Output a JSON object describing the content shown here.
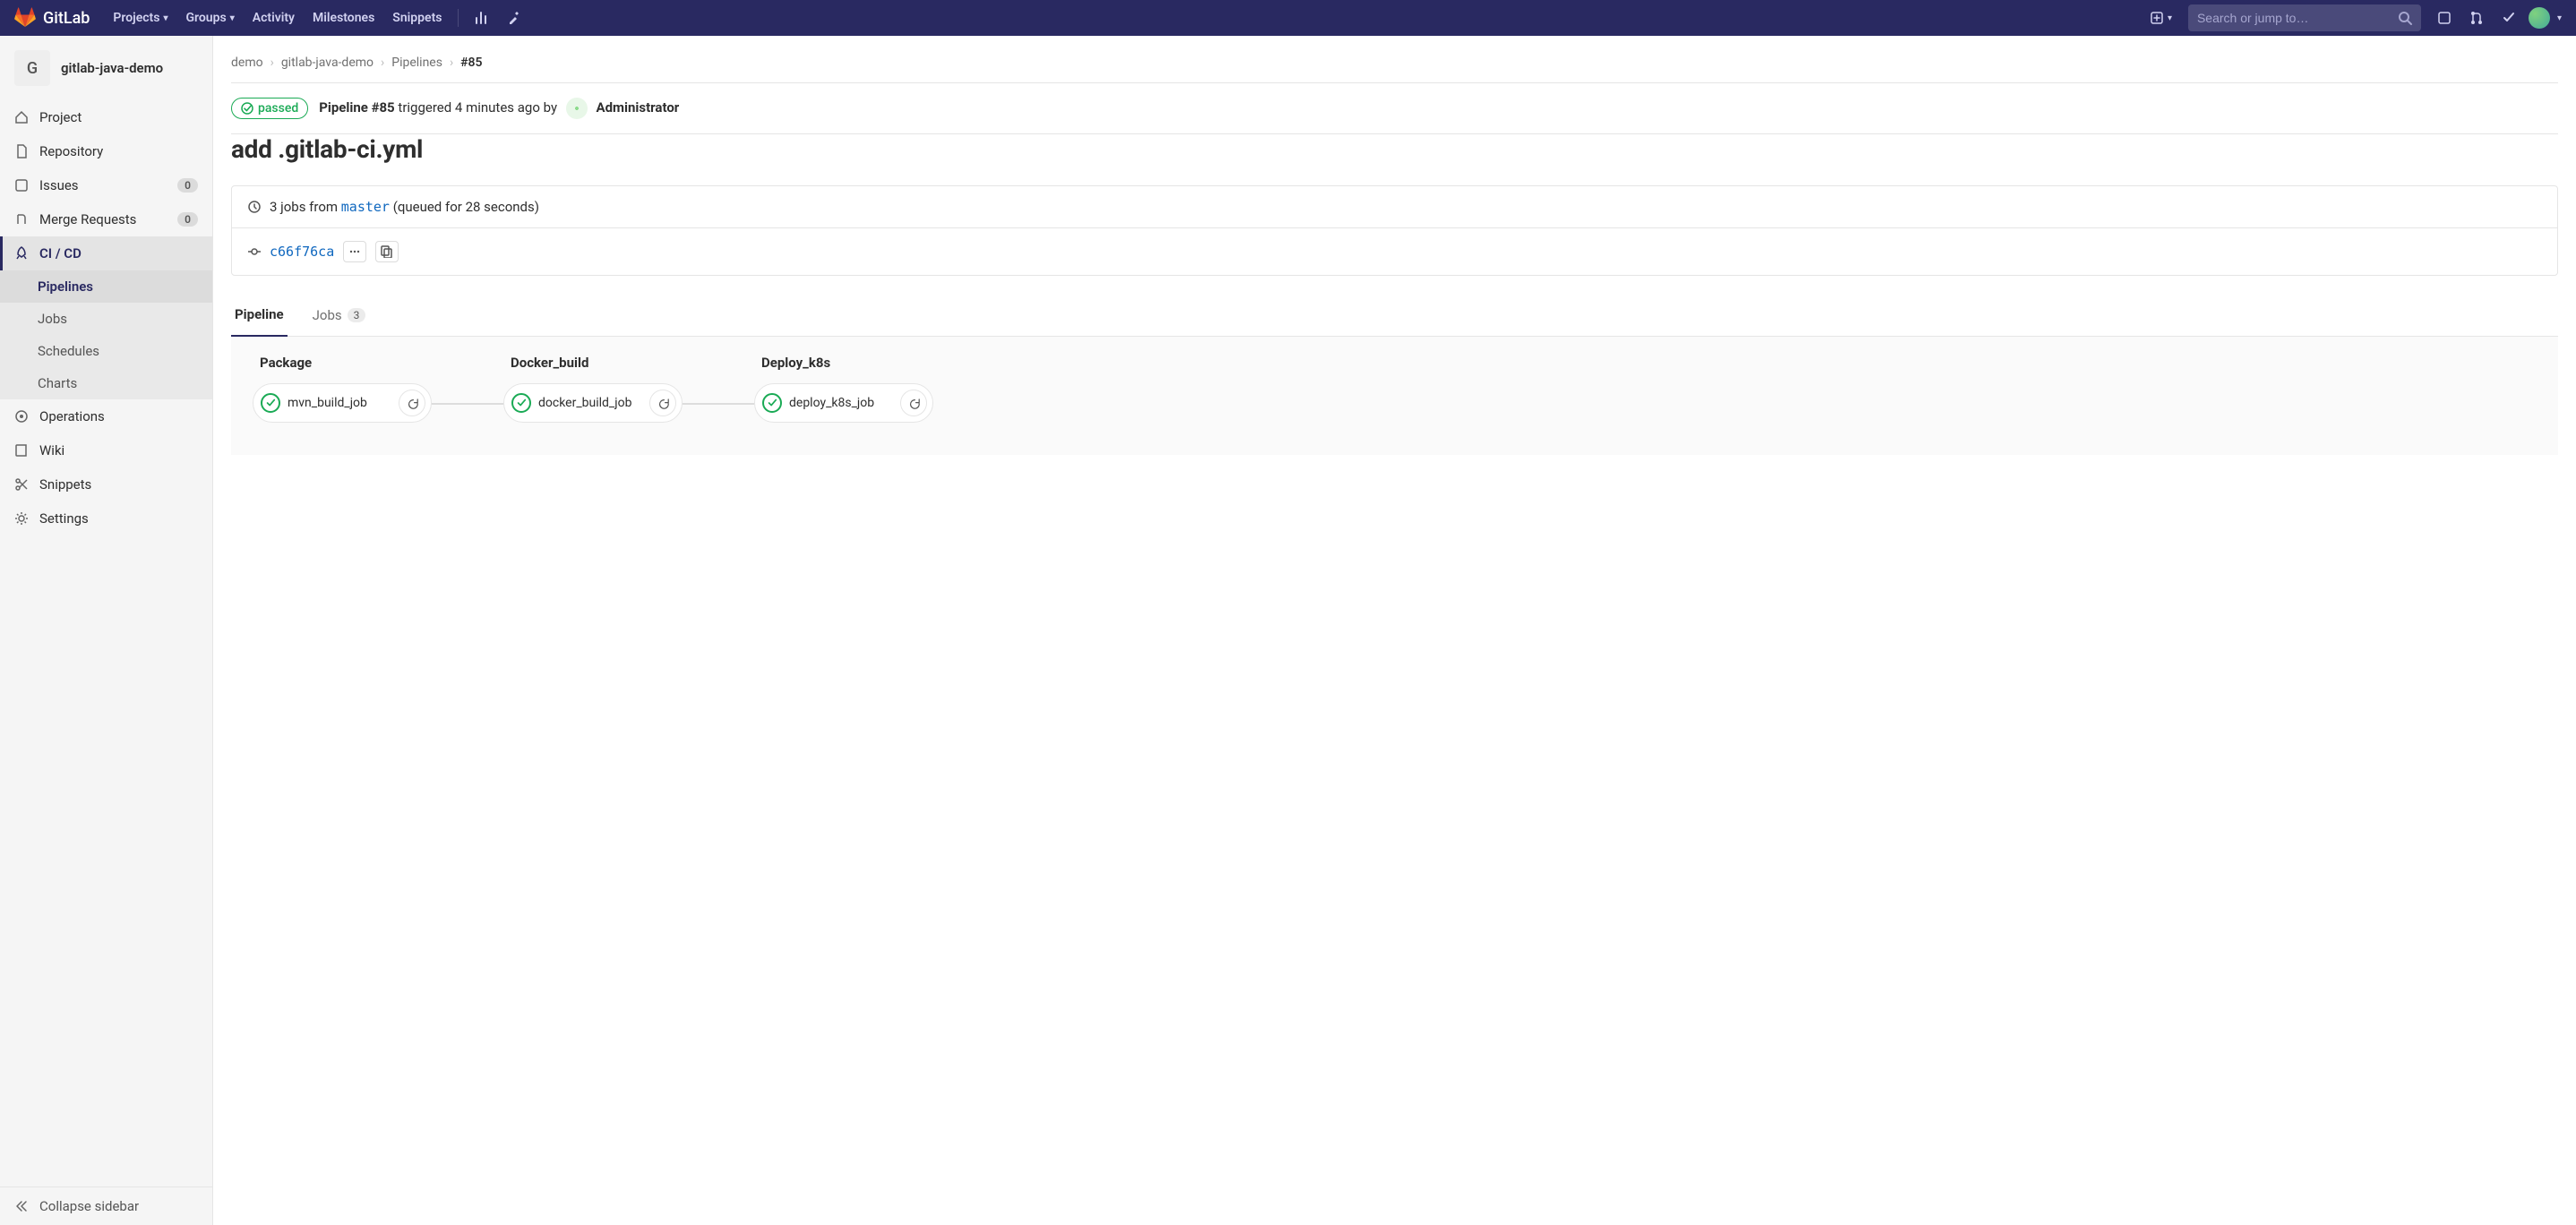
{
  "brand": "GitLab",
  "topnav": {
    "projects": "Projects",
    "groups": "Groups",
    "activity": "Activity",
    "milestones": "Milestones",
    "snippets": "Snippets"
  },
  "search": {
    "placeholder": "Search or jump to…"
  },
  "project": {
    "initial": "G",
    "name": "gitlab-java-demo"
  },
  "sidebar": {
    "project": "Project",
    "repository": "Repository",
    "issues": "Issues",
    "issues_count": "0",
    "merge_requests": "Merge Requests",
    "mr_count": "0",
    "cicd": "CI / CD",
    "pipelines": "Pipelines",
    "jobs": "Jobs",
    "schedules": "Schedules",
    "charts": "Charts",
    "operations": "Operations",
    "wiki": "Wiki",
    "snippets": "Snippets",
    "settings": "Settings",
    "collapse": "Collapse sidebar"
  },
  "breadcrumbs": {
    "group": "demo",
    "project": "gitlab-java-demo",
    "section": "Pipelines",
    "current": "#85"
  },
  "pipeline": {
    "status": "passed",
    "id": "Pipeline #85",
    "triggered_text": "triggered 4 minutes ago by",
    "user": "Administrator",
    "commit_title": "add .gitlab-ci.yml",
    "jobs_summary_prefix": "3 jobs from",
    "branch": "master",
    "jobs_summary_suffix": "(queued for 28 seconds)",
    "sha": "c66f76ca"
  },
  "tabs": {
    "pipeline": "Pipeline",
    "jobs": "Jobs",
    "jobs_count": "3"
  },
  "stages": [
    {
      "name": "Package",
      "job": "mvn_build_job"
    },
    {
      "name": "Docker_build",
      "job": "docker_build_job"
    },
    {
      "name": "Deploy_k8s",
      "job": "deploy_k8s_job"
    }
  ]
}
